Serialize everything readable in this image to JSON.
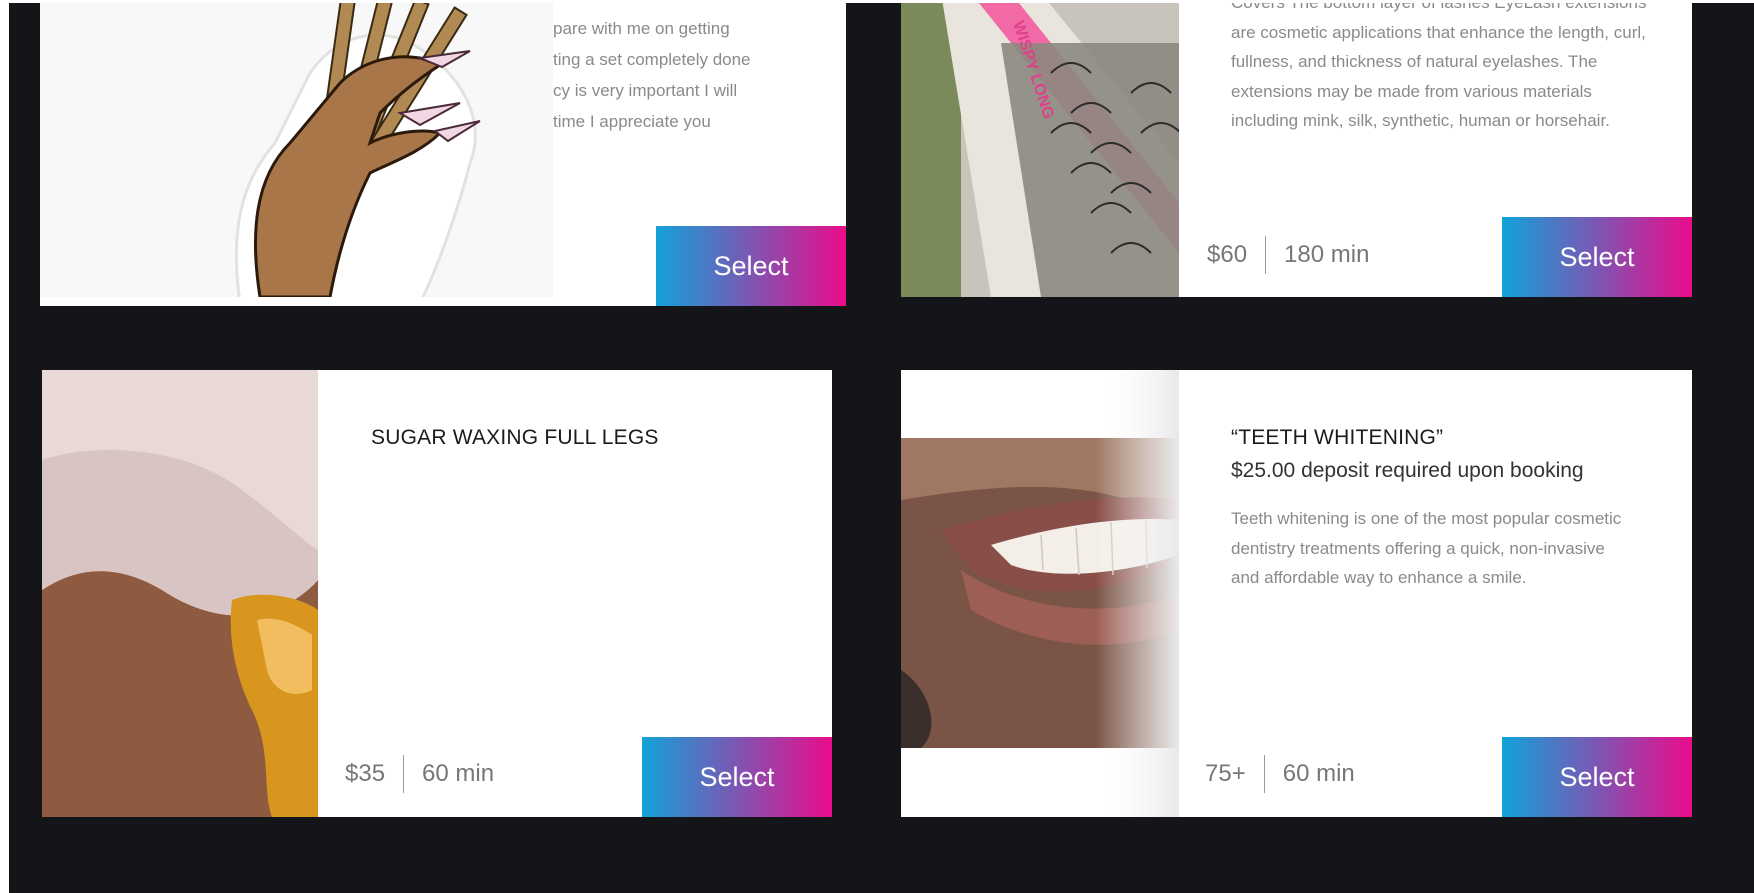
{
  "cards": [
    {
      "id": "card-top-left",
      "title": "",
      "description": "pare with me on getting\nting a set completely done\ncy is very important I will\n time I appreciate you",
      "price": "",
      "duration": "",
      "select_label": "Select",
      "image_alt": "nail-art-hand-illustration"
    },
    {
      "id": "card-top-right",
      "title": "",
      "description": "Covers The bottom layer of lashes EyeLash extensions are cosmetic applications that enhance the length, curl, fullness, and thickness of natural eyelashes. The extensions may be made from various materials including mink, silk, synthetic, human or horsehair.",
      "price": "$60",
      "duration": "180 min",
      "select_label": "Select",
      "image_alt": "wispy-long-lash-pack",
      "image_text": "WISPY LONG"
    },
    {
      "id": "card-bottom-left",
      "title": "SUGAR WAXING FULL LEGS",
      "description": "",
      "price": "$35",
      "duration": "60 min",
      "select_label": "Select",
      "image_alt": "sugar-wax-gloved-hand"
    },
    {
      "id": "card-bottom-right",
      "title": "“TEETH WHITENING”",
      "subtitle": "$25.00 deposit required upon booking",
      "description": "Teeth whitening is one of the most popular cosmetic dentistry treatments offering a quick, non-invasive and affordable way to enhance a smile.",
      "price": "75+",
      "duration": "60 min",
      "select_label": "Select",
      "image_alt": "smiling-teeth-closeup"
    }
  ],
  "colors": {
    "page_bg": "#141519",
    "card_bg": "#ffffff",
    "button_gradient_start": "#12a2d8",
    "button_gradient_end": "#ea0c8a",
    "text_muted": "#8a8a8a"
  }
}
